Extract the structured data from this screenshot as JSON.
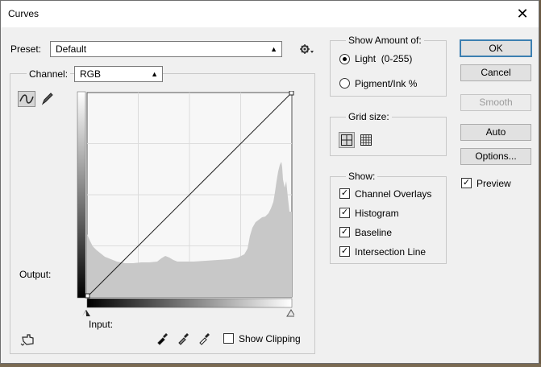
{
  "window": {
    "title": "Curves",
    "close_glyph": "✕"
  },
  "preset": {
    "label": "Preset:",
    "value": "Default"
  },
  "channel": {
    "label": "Channel:",
    "value": "RGB"
  },
  "graph": {
    "output_label": "Output:",
    "input_label": "Input:",
    "show_clipping_label": "Show Clipping",
    "show_clipping_checked": false
  },
  "show_amount": {
    "title": "Show Amount of:",
    "light_label": "Light  (0-255)",
    "pigment_label": "Pigment/Ink %",
    "selected": "light"
  },
  "grid_size": {
    "title": "Grid size:"
  },
  "show": {
    "title": "Show:",
    "items": [
      {
        "label": "Channel Overlays",
        "checked": true
      },
      {
        "label": "Histogram",
        "checked": true
      },
      {
        "label": "Baseline",
        "checked": true
      },
      {
        "label": "Intersection Line",
        "checked": true
      }
    ]
  },
  "buttons": {
    "ok": "OK",
    "cancel": "Cancel",
    "smooth": "Smooth",
    "auto": "Auto",
    "options": "Options..."
  },
  "preview": {
    "label": "Preview",
    "checked": true
  },
  "check_glyph": "✓",
  "colors": {
    "dialog_bg": "#f0f0f0",
    "histogram": "#c8c8c8",
    "graph_bg": "#f7f7f7",
    "primary_border": "#3c7fb1"
  }
}
